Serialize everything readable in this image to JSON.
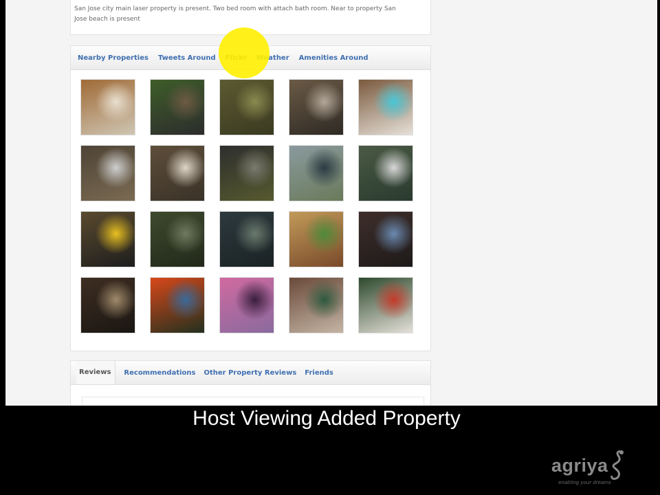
{
  "property": {
    "description": "San Jose city main laser property is present. Two bed room with attach bath room. Near to property San Jose beach is present"
  },
  "photo_tabs": [
    "Nearby Properties",
    "Tweets Around",
    "Flickr",
    "Weather",
    "Amenities Around"
  ],
  "photo_tab_active": "Flickr",
  "photos": [
    {
      "name": "food-plate-photo",
      "colors": [
        "#a06a36",
        "#e8e0d0",
        "#cfc6b4"
      ]
    },
    {
      "name": "garden-sign-photo",
      "colors": [
        "#3e5e2a",
        "#6e5a44",
        "#2c2c2c"
      ]
    },
    {
      "name": "tree-canopy-photo",
      "colors": [
        "#5c5a30",
        "#8a8a50",
        "#3a3a22"
      ]
    },
    {
      "name": "branches-photo",
      "colors": [
        "#6b5a46",
        "#b4a89a",
        "#2e2a24"
      ]
    },
    {
      "name": "bottle-ground-photo",
      "colors": [
        "#7a5a3e",
        "#49c6d6",
        "#e6e0d8"
      ]
    },
    {
      "name": "debris-ground-photo",
      "colors": [
        "#4e4436",
        "#cfcfcf",
        "#7a6a52"
      ]
    },
    {
      "name": "stump-photo",
      "colors": [
        "#5e4e3a",
        "#ded6c8",
        "#3a3228"
      ]
    },
    {
      "name": "post-cap-photo",
      "colors": [
        "#2e2e2e",
        "#7a7a6e",
        "#565a2e"
      ]
    },
    {
      "name": "fence-blue-photo",
      "colors": [
        "#8a9a9e",
        "#2a3a42",
        "#6a7a5a"
      ]
    },
    {
      "name": "metal-frame-photo",
      "colors": [
        "#4a5a44",
        "#d8d8d8",
        "#2a3a2e"
      ]
    },
    {
      "name": "bollard-photo",
      "colors": [
        "#5a4a2e",
        "#e8c020",
        "#1e1e1e"
      ]
    },
    {
      "name": "forest-canopy-photo",
      "colors": [
        "#3e4a2e",
        "#6e7a5e",
        "#22281a"
      ]
    },
    {
      "name": "trunk-closeup-photo",
      "colors": [
        "#2e3a3e",
        "#6a7a6e",
        "#1a2224"
      ]
    },
    {
      "name": "bowl-dish-photo",
      "colors": [
        "#c29a5a",
        "#4e8a3a",
        "#7a4a2a"
      ]
    },
    {
      "name": "trucks-photo",
      "colors": [
        "#3e2e2a",
        "#6a8ab0",
        "#1e1a1a"
      ]
    },
    {
      "name": "certificate-photo",
      "colors": [
        "#3e2e22",
        "#a08a6a",
        "#1a1612"
      ]
    },
    {
      "name": "red-tree-photo",
      "colors": [
        "#d8481a",
        "#3a6a9a",
        "#22301e"
      ]
    },
    {
      "name": "sunset-silhouette-photo",
      "colors": [
        "#d06aa0",
        "#3a1e3e",
        "#8a6a9e"
      ]
    },
    {
      "name": "ornaments-photo",
      "colors": [
        "#6a4a3a",
        "#2e5a3e",
        "#c4b4a4"
      ]
    },
    {
      "name": "christmas-tree-photo",
      "colors": [
        "#2e4a2e",
        "#c43a2a",
        "#e4e0d8"
      ]
    }
  ],
  "review_tabs": [
    "Reviews",
    "Recommendations",
    "Other Property Reviews",
    "Friends"
  ],
  "review_tab_active": "Reviews",
  "caption": "Host Viewing Added Property",
  "logo": {
    "name": "agriya",
    "tagline": "enabling your dreams"
  }
}
